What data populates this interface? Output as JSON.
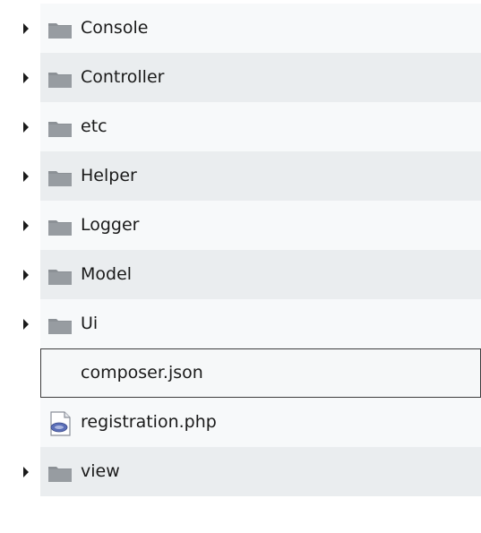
{
  "tree": {
    "items": [
      {
        "label": "Console",
        "kind": "folder",
        "icon": "folder-icon"
      },
      {
        "label": "Controller",
        "kind": "folder",
        "icon": "folder-icon"
      },
      {
        "label": "etc",
        "kind": "folder",
        "icon": "folder-icon"
      },
      {
        "label": "Helper",
        "kind": "folder",
        "icon": "folder-icon"
      },
      {
        "label": "Logger",
        "kind": "folder",
        "icon": "folder-icon"
      },
      {
        "label": "Model",
        "kind": "folder",
        "icon": "folder-icon"
      },
      {
        "label": "Ui",
        "kind": "folder",
        "icon": "folder-icon"
      },
      {
        "label": "composer.json",
        "kind": "file",
        "icon": "none",
        "selected": true
      },
      {
        "label": "registration.php",
        "kind": "file",
        "icon": "php-file-icon"
      },
      {
        "label": "view",
        "kind": "folder",
        "icon": "folder-icon"
      }
    ]
  },
  "colors": {
    "folder": "#8c9196",
    "folder_dark": "#6d7277",
    "row_light": "#f7f9fa",
    "row_dark": "#eaedef",
    "selection_border": "#3d3d3d",
    "text": "#1a1a1a"
  }
}
